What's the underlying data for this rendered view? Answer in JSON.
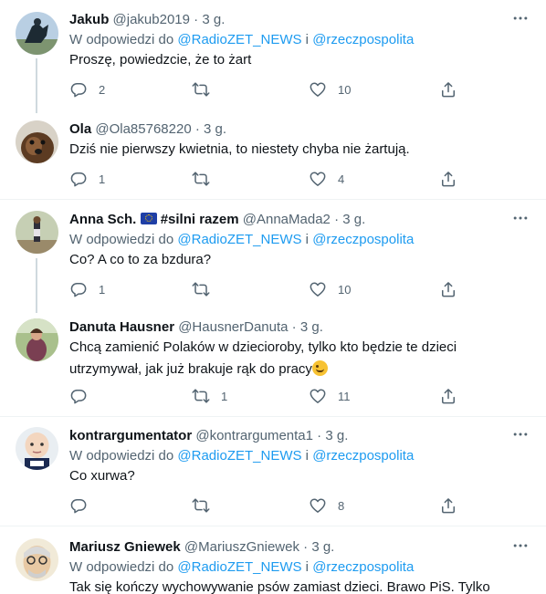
{
  "reply_prefix": "W odpowiedzi do",
  "mention_1": "@RadioZET_NEWS",
  "reply_joiner": "i",
  "mention_2": "@rzeczpospolita",
  "dot": "·",
  "tweets": [
    {
      "name": "Jakub",
      "handle": "@jakub2019",
      "time": "3 g.",
      "text": "Proszę, powiedzcie, że to żart",
      "replies": "2",
      "retweets": "",
      "likes": "10"
    },
    {
      "name": "Ola",
      "handle": "@Ola85768220",
      "time": "3 g.",
      "text": "Dziś nie pierwszy kwietnia, to niestety chyba nie żartują.",
      "replies": "1",
      "retweets": "",
      "likes": "4"
    },
    {
      "name_part1": "Anna Sch.",
      "name_part2": "#silni razem",
      "handle": "@AnnaMada2",
      "time": "3 g.",
      "text": "Co? A co to za bzdura?",
      "replies": "1",
      "retweets": "",
      "likes": "10"
    },
    {
      "name": "Danuta Hausner",
      "handle": "@HausnerDanuta",
      "time": "3 g.",
      "text_line1": "Chcą zamienić Polaków w dziecioroby, tylko kto będzie te dzieci",
      "text_line2": "utrzymywał, jak już brakuje rąk do pracy",
      "replies": "",
      "retweets": "1",
      "likes": "11"
    },
    {
      "name": "kontrargumentator",
      "handle": "@kontrargumenta1",
      "time": "3 g.",
      "text": "Co xurwa?",
      "replies": "",
      "retweets": "",
      "likes": "8"
    },
    {
      "name": "Mariusz Gniewek",
      "handle": "@MariuszGniewek",
      "time": "3 g.",
      "text": "Tak się kończy wychowywanie psów zamiast dzieci. Brawo PiS. Tylko"
    }
  ],
  "icons": {
    "reply": "reply-icon",
    "retweet": "retweet-icon",
    "like": "like-icon",
    "share": "share-icon",
    "more": "more-icon",
    "eu_flag": "eu-flag-icon",
    "wink": "wink-emoji-icon"
  },
  "colors": {
    "link": "#1d9bf0",
    "secondary_text": "#536471",
    "primary_text": "#0f1419",
    "thread_line": "#cfd9de",
    "separator": "#eff3f4"
  }
}
